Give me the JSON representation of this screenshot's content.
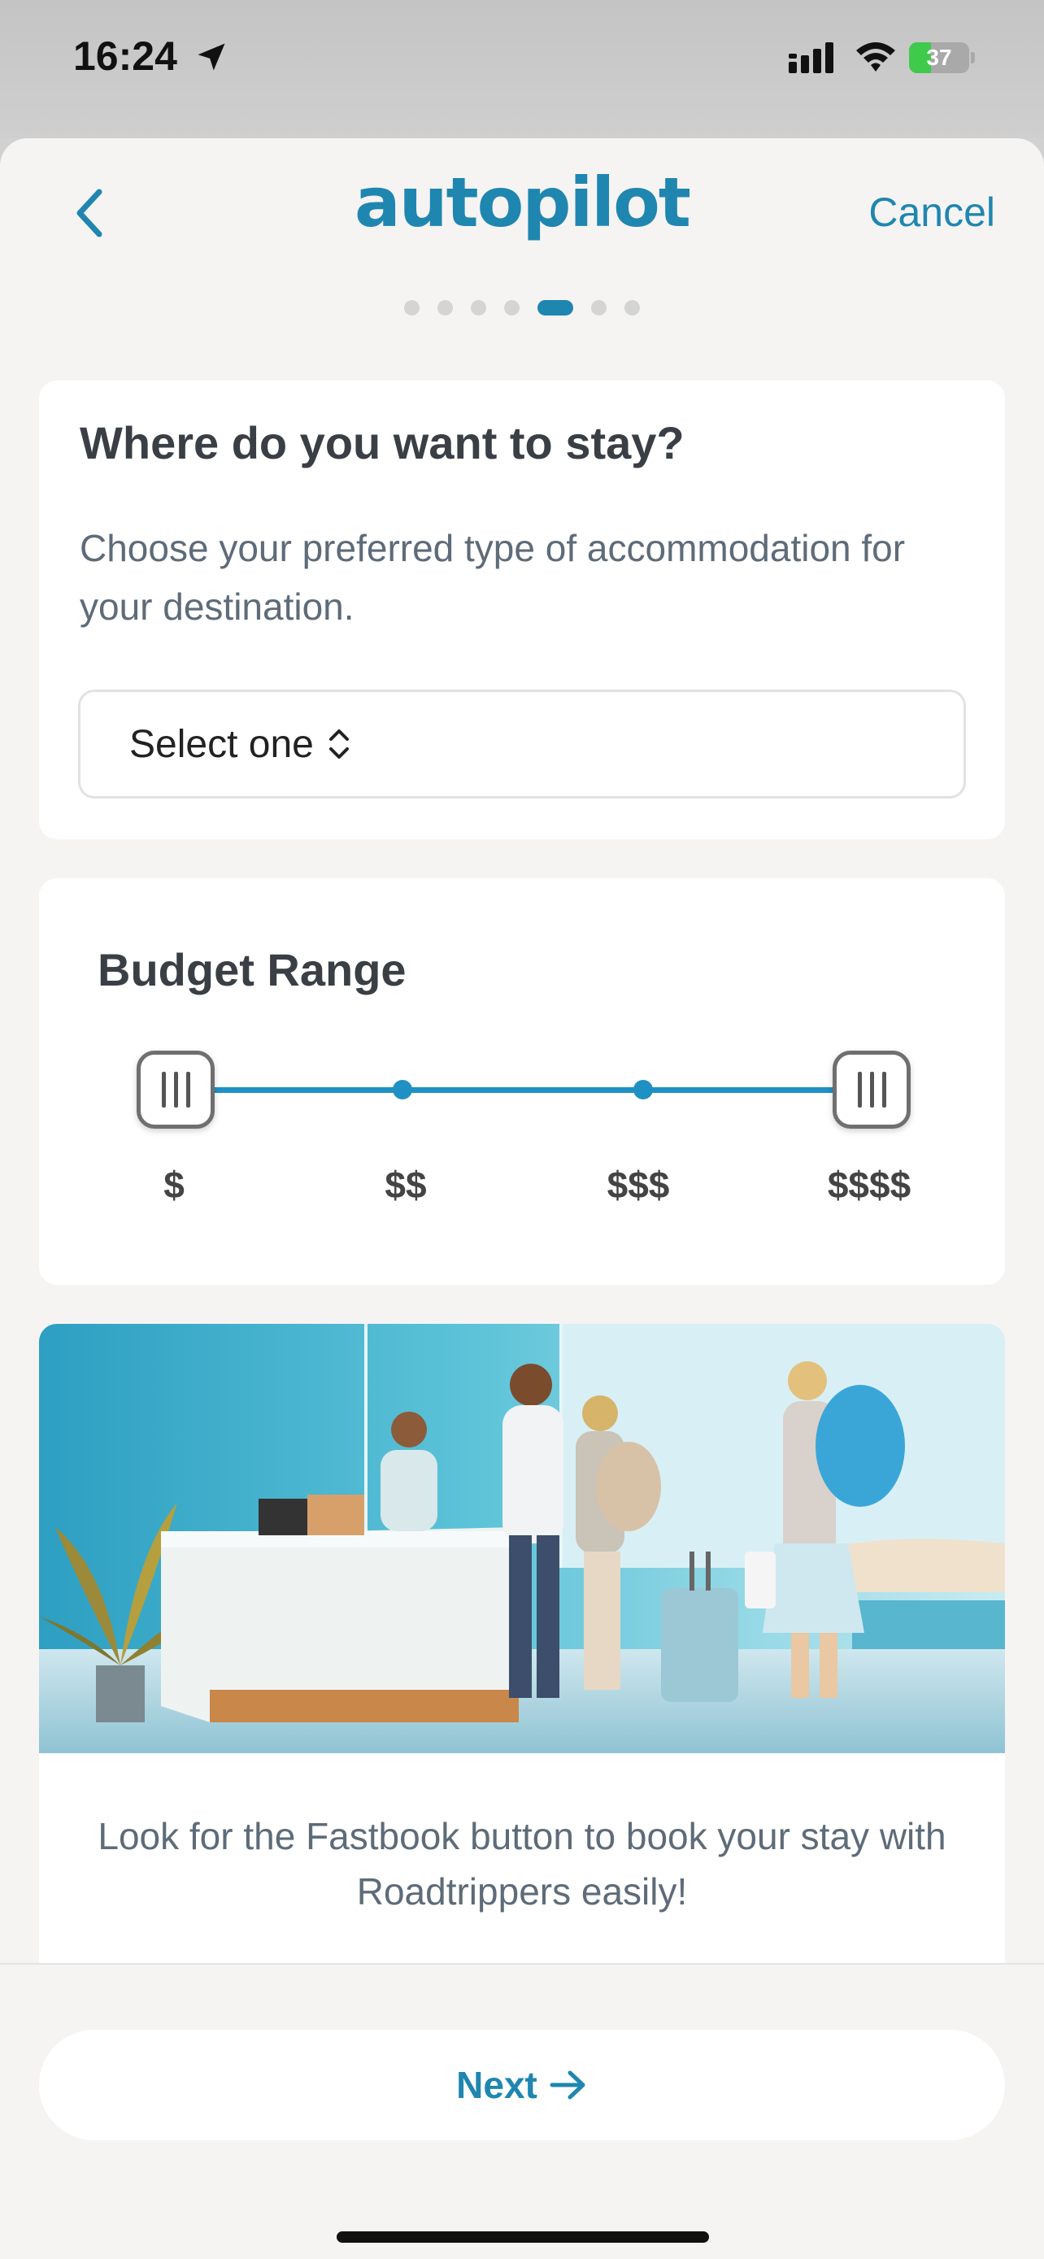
{
  "status_bar": {
    "time": "16:24",
    "battery_percent": "37",
    "battery_level": 0.37,
    "icons": [
      "location-arrow-icon",
      "cellular-signal-icon",
      "wifi-icon",
      "battery-charging-icon"
    ]
  },
  "header": {
    "logo_text": "autopilot",
    "cancel_label": "Cancel",
    "back_icon": "chevron-left-icon",
    "progress": {
      "total_steps": 7,
      "current_step": 5
    }
  },
  "accommodation": {
    "title": "Where do you want to stay?",
    "description": "Choose your preferred type of accommodation for your destination.",
    "select": {
      "value": "Select one",
      "icon": "chevron-up-down-icon"
    }
  },
  "budget": {
    "title": "Budget Range",
    "tiers": [
      "$",
      "$$",
      "$$$",
      "$$$$"
    ],
    "selected_min": "$",
    "selected_max": "$$$$"
  },
  "promo": {
    "text": "Look for the Fastbook button to book your stay with Roadtrippers easily!"
  },
  "footer": {
    "next_label": "Next",
    "next_icon": "arrow-right-icon"
  },
  "colors": {
    "accent": "#1f86b0",
    "slider": "#1f90c4",
    "battery": "#3fca4c"
  }
}
